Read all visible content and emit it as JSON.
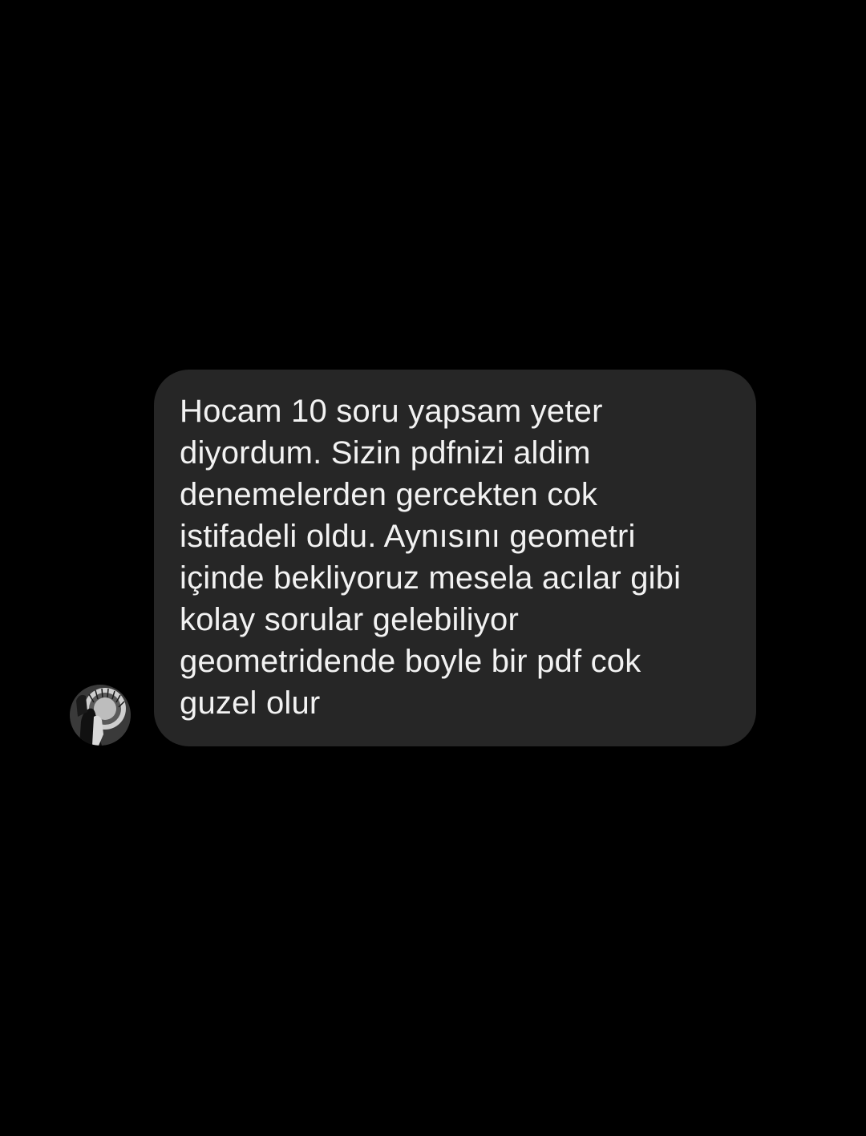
{
  "chat": {
    "incoming_message": {
      "text": "Hocam 10 soru yapsam yeter\ndiyordum. Sizin pdfnizi aldim\ndenemelerden gercekten cok\nistifadeli oldu. Aynısını geometri\niçinde bekliyoruz mesela acılar gibi\nkolay sorular gelebiliyor\ngeometridende boyle bir pdf cok\nguzel olur"
    },
    "sender_avatar": {
      "icon": "profile-photo"
    }
  },
  "colors": {
    "background": "#000000",
    "bubble": "#262626",
    "text": "#f2f2f2"
  }
}
